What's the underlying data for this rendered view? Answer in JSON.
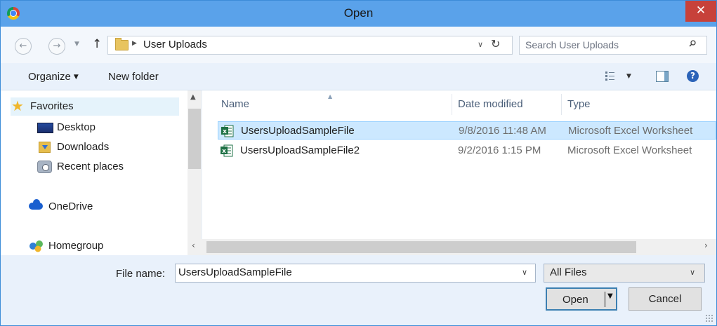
{
  "window": {
    "title": "Open",
    "close_label": "✕"
  },
  "address_bar": {
    "breadcrumb": "User Uploads",
    "search_placeholder": "Search User Uploads"
  },
  "toolbar": {
    "organize": "Organize",
    "new_folder": "New folder"
  },
  "nav_pane": {
    "items": [
      {
        "label": "Favorites",
        "icon": "star-icon"
      },
      {
        "label": "Desktop",
        "icon": "desktop-icon"
      },
      {
        "label": "Downloads",
        "icon": "downloads-icon"
      },
      {
        "label": "Recent places",
        "icon": "recent-places-icon"
      },
      {
        "label": "OneDrive",
        "icon": "onedrive-icon"
      },
      {
        "label": "Homegroup",
        "icon": "homegroup-icon"
      }
    ]
  },
  "file_list": {
    "columns": [
      "Name",
      "Date modified",
      "Type"
    ],
    "rows": [
      {
        "name": "UsersUploadSampleFile",
        "date": "9/8/2016 11:48 AM",
        "type": "Microsoft Excel Worksheet",
        "selected": true
      },
      {
        "name": "UsersUploadSampleFile2",
        "date": "9/2/2016 1:15 PM",
        "type": "Microsoft Excel Worksheet",
        "selected": false
      }
    ]
  },
  "bottom": {
    "file_name_label": "File name:",
    "file_name_value": "UsersUploadSampleFile",
    "file_type_filter": "All Files",
    "open_label": "Open",
    "cancel_label": "Cancel"
  },
  "colors": {
    "title_bar": "#5aa2ea",
    "close_button": "#c7413a",
    "selection": "#cce8ff",
    "excel_green": "#1e7145"
  }
}
